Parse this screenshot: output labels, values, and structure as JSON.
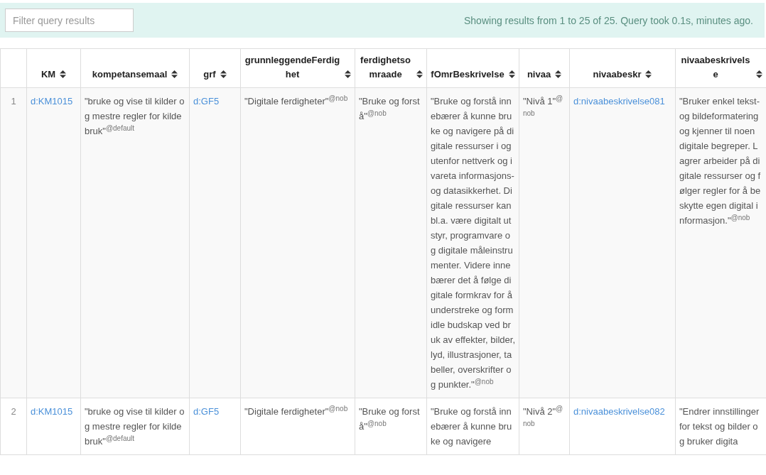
{
  "filter": {
    "placeholder": "Filter query results"
  },
  "status": "Showing results from 1 to 25 of 25. Query took 0.1s, minutes ago.",
  "table": {
    "columns": [
      {},
      {
        "label": "KM",
        "sortable": true
      },
      {
        "label": "kompetansemaal",
        "sortable": true
      },
      {
        "label": "grf",
        "sortable": true
      },
      {
        "label": "grunnleggendeFerdighet",
        "sortable": true
      },
      {
        "label": "ferdighetsomraade",
        "sortable": true
      },
      {
        "label": "fOmrBeskrivelse",
        "sortable": true
      },
      {
        "label": "nivaa",
        "sortable": true
      },
      {
        "label": "nivaabeskr",
        "sortable": true
      },
      {
        "label": "nivaabeskrivelse",
        "sortable": true
      }
    ],
    "rows": [
      {
        "cells": [
          {
            "kind": "index",
            "text": "1"
          },
          {
            "kind": "uri",
            "text": "d:KM1015"
          },
          {
            "kind": "literal",
            "text": "\"bruke og vise til kilder og mestre regler for kildebruk\"$^{@default}$"
          },
          {
            "kind": "uri",
            "text": "d:GF5"
          },
          {
            "kind": "literal",
            "text": "\"Digitale ferdigheter\"$^{@nob}$"
          },
          {
            "kind": "literal",
            "text": "\"Bruke og forstå\"$^{@nob}$"
          },
          {
            "kind": "literal",
            "text": "\"Bruke og forstå innebærer å kunne bruke og navigere på digitale ressurser i og utenfor nettverk og ivareta informasjons- og datasikkerhet. Digitale ressurser kan bl.a. være digitalt utstyr, programvare og digitale måleinstrumenter. Videre innebærer det å følge digitale formkrav for å understreke og formidle budskap ved bruk av effekter, bilder, lyd, illustrasjoner, tabeller, overskrifter og punkter.\"$^{@nob}$"
          },
          {
            "kind": "literal",
            "text": "\"Nivå 1\"$^{@nob}$"
          },
          {
            "kind": "uri",
            "text": "d:nivaabeskrivelse081"
          },
          {
            "kind": "literal",
            "text": "\"Bruker enkel tekst- og bildeformatering og kjenner til noen digitale begreper. Lagrer arbeider på digitale ressurser og følger regler for å beskytte egen digital informasjon.\"$^{@nob}$"
          }
        ]
      },
      {
        "cells": [
          {
            "kind": "index",
            "text": "2"
          },
          {
            "kind": "uri",
            "text": "d:KM1015"
          },
          {
            "kind": "literal",
            "text": "\"bruke og vise til kilder og mestre regler for kildebruk\"$^{@default}$"
          },
          {
            "kind": "uri",
            "text": "d:GF5"
          },
          {
            "kind": "literal",
            "text": "\"Digitale ferdigheter\"$^{@nob}$"
          },
          {
            "kind": "literal",
            "text": "\"Bruke og forstå\"$^{@nob}$"
          },
          {
            "kind": "literal",
            "text": "\"Bruke og forstå innebærer å kunne bruke og navigere"
          },
          {
            "kind": "literal",
            "text": "\"Nivå 2\"$^{@nob}$"
          },
          {
            "kind": "uri",
            "text": "d:nivaabeskrivelse082"
          },
          {
            "kind": "literal",
            "text": "\"Endrer innstillinger for tekst og bilder og bruker digita"
          }
        ]
      }
    ]
  }
}
